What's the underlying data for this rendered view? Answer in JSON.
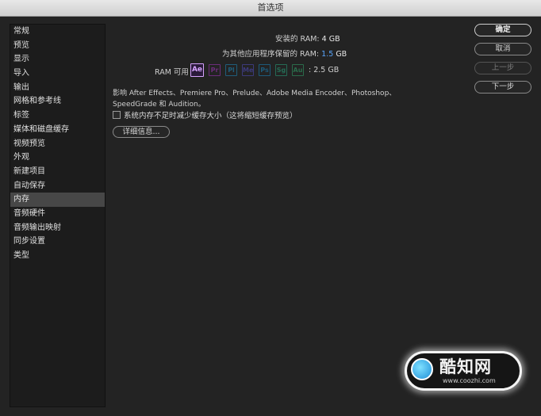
{
  "window": {
    "title": "首选项"
  },
  "sidebar": {
    "items": [
      {
        "label": "常规"
      },
      {
        "label": "预览"
      },
      {
        "label": "显示"
      },
      {
        "label": "导入"
      },
      {
        "label": "输出"
      },
      {
        "label": "网格和参考线"
      },
      {
        "label": "标签"
      },
      {
        "label": "媒体和磁盘缓存"
      },
      {
        "label": "视频预览"
      },
      {
        "label": "外观"
      },
      {
        "label": "新建项目"
      },
      {
        "label": "自动保存"
      },
      {
        "label": "内存"
      },
      {
        "label": "音频硬件"
      },
      {
        "label": "音频输出映射"
      },
      {
        "label": "同步设置"
      },
      {
        "label": "类型"
      }
    ],
    "selected": "内存"
  },
  "memory": {
    "installed_label": "安装的 RAM:",
    "installed_value": "4 GB",
    "reserved_label": "为其他应用程序保留的 RAM:",
    "reserved_value": "1.5",
    "reserved_unit": "GB",
    "available_label": "RAM 可用",
    "available_value": ": 2.5 GB",
    "apps": [
      {
        "abbr": "Ae",
        "color": "#d7a3ff",
        "active": true
      },
      {
        "abbr": "Pr",
        "color": "#6b2d7a"
      },
      {
        "abbr": "Pl",
        "color": "#1f5d7a"
      },
      {
        "abbr": "Me",
        "color": "#3c3a7a"
      },
      {
        "abbr": "Ps",
        "color": "#1d5a7a"
      },
      {
        "abbr": "Sg",
        "color": "#256b55"
      },
      {
        "abbr": "Au",
        "color": "#2a6b4a"
      }
    ],
    "affects_text": "影响 After Effects、Premiere Pro、Prelude、Adobe Media Encoder、Photoshop、SpeedGrade 和 Audition。",
    "checkbox_label": "系统内存不足时减少缓存大小（这将缩短缓存预览）",
    "checkbox_checked": false,
    "details_button": "详细信息..."
  },
  "buttons": {
    "ok": "确定",
    "cancel": "取消",
    "prev": "上一步",
    "next": "下一步"
  },
  "watermark": {
    "name": "酷知网",
    "url": "www.coozhi.com"
  }
}
